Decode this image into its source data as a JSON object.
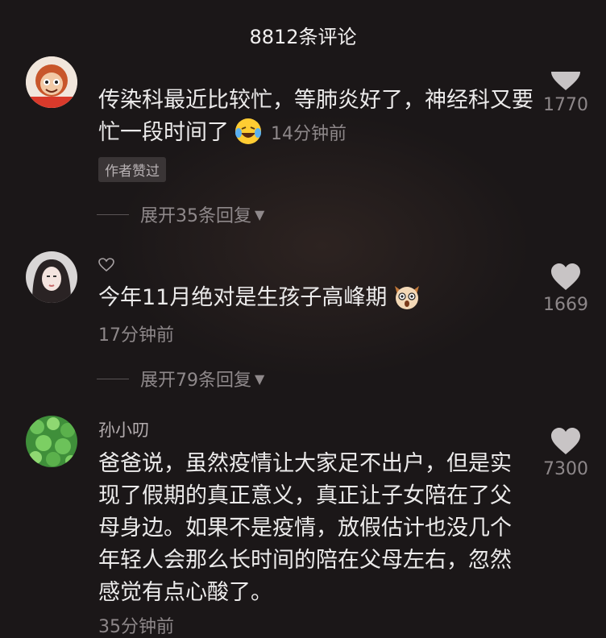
{
  "header": {
    "title": "8812条评论"
  },
  "comments": [
    {
      "text": "传染科最近比较忙，等肺炎好了，神经科又要忙一段时间了",
      "time": "14分钟前",
      "author_tag": "作者赞过",
      "replies_label": "展开35条回复",
      "likes": "1770",
      "emoji": "laughing-tears-emoji"
    },
    {
      "text": "今年11月绝对是生孩子高峰期",
      "time": "17分钟前",
      "replies_label": "展开79条回复",
      "likes": "1669",
      "emoji": "dog-face-emoji"
    },
    {
      "username": "孙小叨",
      "text": "爸爸说，虽然疫情让大家足不出户，但是实现了假期的真正意义，真正让子女陪在了父母身边。如果不是疫情，放假估计也没几个年轻人会那么长时间的陪在父母左右，忽然感觉有点心酸了。",
      "time": "35分钟前",
      "likes": "7300"
    }
  ],
  "icons": {
    "like": "heart-icon",
    "expand": "triangle-down-icon",
    "username_heart": "heart-outline-icon"
  }
}
